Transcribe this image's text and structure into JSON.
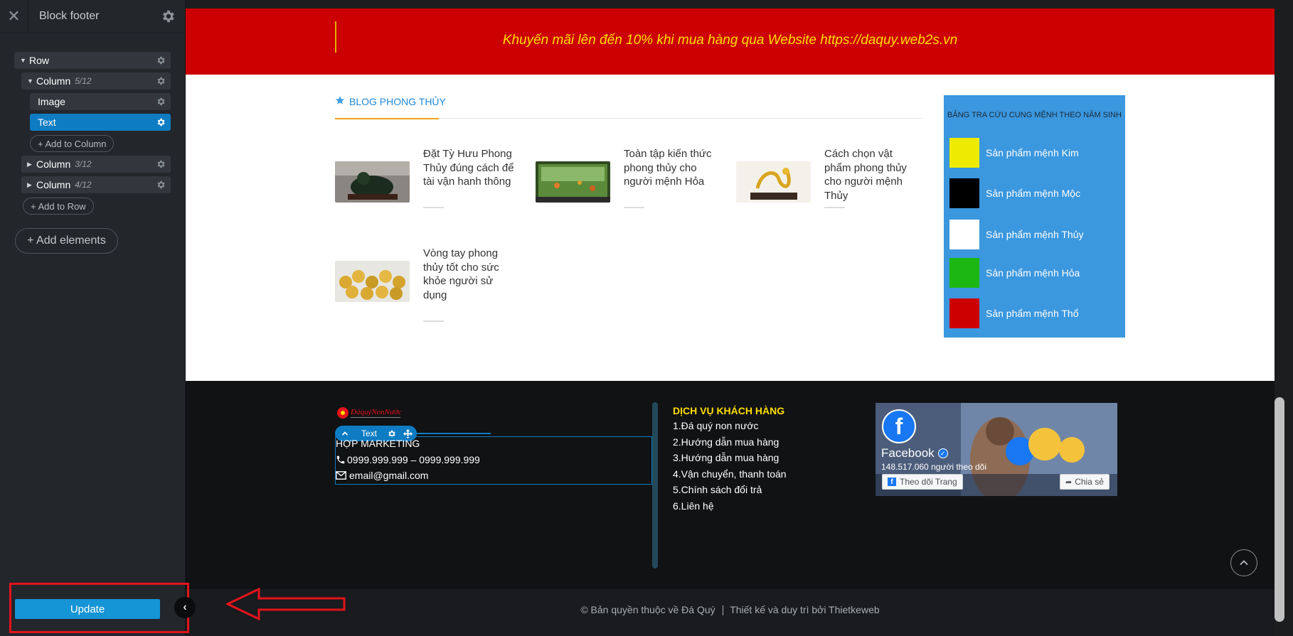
{
  "sidebar": {
    "title": "Block footer",
    "tree": {
      "row": "Row",
      "column1": {
        "label": "Column",
        "meta": "5/12"
      },
      "image": "Image",
      "text": "Text",
      "add_to_column": "+ Add to Column",
      "column2": {
        "label": "Column",
        "meta": "3/12"
      },
      "column3": {
        "label": "Column",
        "meta": "4/12"
      },
      "add_to_row": "+ Add to Row"
    },
    "add_elements": "+ Add elements",
    "update": "Update"
  },
  "page": {
    "banner": "Khuyến mãi lên đến 10% khi mua hàng qua Website https://daquy.web2s.vn",
    "blog_title": "BLOG PHONG THỦY",
    "posts": [
      {
        "title": "Đặt Tỳ Hưu Phong Thủy đúng cách để tài vận hanh thông"
      },
      {
        "title": " Toàn tập kiến thức phong thủy cho người mệnh Hỏa"
      },
      {
        "title": "Cách chọn vật phẩm phong thủy cho người mệnh Thủy"
      },
      {
        "title": "Vòng tay phong thủy tốt cho sức khỏe người sử dụng"
      }
    ],
    "lookup": {
      "heading": "BẢNG TRA CỨU CUNG MỆNH THEO NĂM SINH",
      "items": [
        {
          "label": "Sản phẩm mệnh Kim",
          "color": "#eeeb00"
        },
        {
          "label": "Sản phẩm mệnh Mộc",
          "color": "#000000"
        },
        {
          "label": "Sản phẩm mệnh Thủy",
          "color": "#ffffff"
        },
        {
          "label": "Sản phẩm mệnh Hỏa",
          "color": "#1db713"
        },
        {
          "label": "Sản phẩm mệnh Thổ",
          "color": "#cc0000"
        }
      ]
    }
  },
  "footer": {
    "logo_text": "ĐáquýNonNước",
    "toolbar_label": "Text",
    "contact": {
      "line1": "HỢP MARKETING",
      "phone": "0999.999.999 – 0999.999.999",
      "email": "email@gmail.com"
    },
    "services": {
      "heading": "DỊCH VỤ KHÁCH HÀNG",
      "items": [
        "1.Đá quý non nước",
        "2.Hướng dẫn mua hàng",
        "3.Hướng dẫn mua hàng",
        "4.Vận chuyển, thanh toán",
        "5.Chính sách đổi trả",
        "6.Liên hệ"
      ]
    },
    "facebook": {
      "name": "Facebook",
      "followers": "148.517.060 người theo dõi",
      "follow": "Theo dõi Trang",
      "share": "Chia sẻ"
    },
    "copyright": "© Bản quyền thuộc về Đá Quý",
    "designed": "Thiết kế và duy trì bởi Thietkeweb"
  },
  "colors": {
    "accent": "#0e7cc2",
    "banner": "#cc0000",
    "banner_text": "#ffde00",
    "annotation": "#e3131a"
  },
  "icons": [
    "close-icon",
    "gear-icon",
    "star-icon",
    "phone-icon",
    "mail-icon",
    "chevron-up-icon",
    "chevron-left-icon",
    "facebook-icon",
    "verified-icon",
    "share-icon",
    "plus-icon"
  ]
}
